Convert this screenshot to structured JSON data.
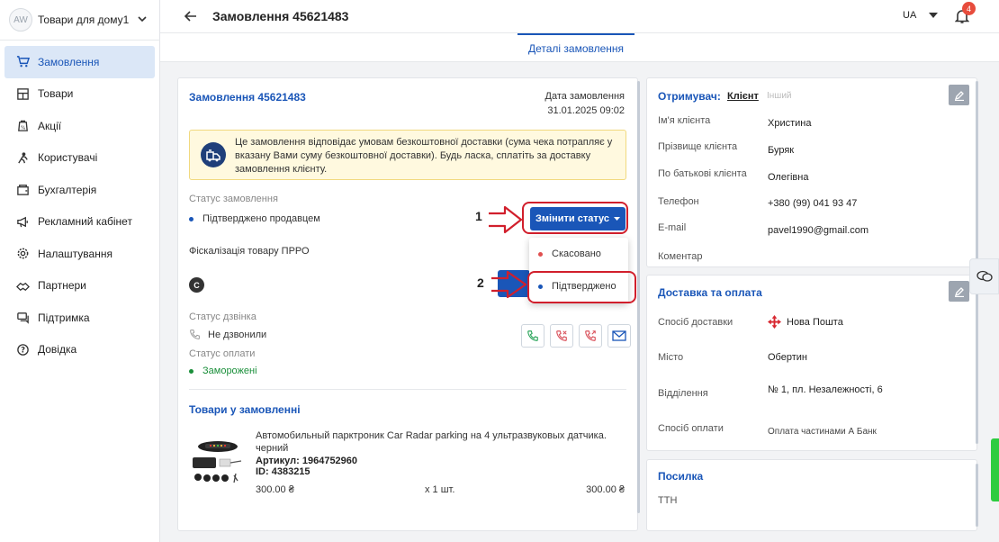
{
  "sidebar": {
    "avatar": "AW",
    "shop_name": "Товари для дому1",
    "items": [
      {
        "label": "Замовлення",
        "icon": "cart-icon",
        "active": true
      },
      {
        "label": "Товари",
        "icon": "store-icon"
      },
      {
        "label": "Акції",
        "icon": "promo-icon"
      },
      {
        "label": "Користувачі",
        "icon": "users-icon"
      },
      {
        "label": "Бухгалтерія",
        "icon": "accounting-icon"
      },
      {
        "label": "Рекламний кабінет",
        "icon": "megaphone-icon"
      },
      {
        "label": "Налаштування",
        "icon": "gear-icon"
      },
      {
        "label": "Партнери",
        "icon": "handshake-icon"
      },
      {
        "label": "Підтримка",
        "icon": "support-icon"
      },
      {
        "label": "Довідка",
        "icon": "help-icon"
      }
    ]
  },
  "header": {
    "title": "Замовлення 45621483",
    "language": "UA",
    "notifications": "4"
  },
  "tabs": {
    "active": "Деталі замовлення"
  },
  "order": {
    "title": "Замовлення 45621483",
    "date_label": "Дата замовлення",
    "date_value": "31.01.2025 09:02",
    "alert": "Це замовлення відповідає умовам безкоштовної доставки (сума чека потрапляє у вказану Вами суму безкоштовної доставки). Будь ласка, сплатіть за доставку замовлення клієнту.",
    "status_label": "Статус замовлення",
    "status_value": "Підтверджено продавцем",
    "change_status_button": "Змінити статус",
    "status_options": [
      "Скасовано",
      "Підтверджено"
    ],
    "fiscal_label": "Фіскалізація товару ПРРО",
    "fiscal_badge": "C",
    "call_label": "Статус дзвінка",
    "call_value": "Не дзвонили",
    "payment_label": "Статус оплати",
    "payment_value": "Заморожені",
    "goods_title": "Товари у замовленні",
    "product": {
      "name": "Автомобильный парктроник Car Radar parking на 4 ультразвуковых датчика. черний",
      "article": "Артикул: 1964752960",
      "id": "ID: 4383215",
      "price": "300.00 ₴",
      "qty": "x 1 шт.",
      "total": "300.00 ₴"
    }
  },
  "recipient": {
    "title": "Отримувач:",
    "seg_client": "Клієнт",
    "seg_other": "Інший",
    "fields": [
      {
        "label": "Ім'я клієнта",
        "value": "Христина"
      },
      {
        "label": "Прізвище клієнта",
        "value": "Буряк"
      },
      {
        "label": "По батькові клієнта",
        "value": "Олегівна"
      },
      {
        "label": "Телефон",
        "value": "+380 (99) 041 93 47"
      },
      {
        "label": "E-mail",
        "value": "pavel1990@gmail.com"
      },
      {
        "label": "Коментар",
        "value": ""
      }
    ]
  },
  "delivery": {
    "title": "Доставка та оплата",
    "fields": [
      {
        "label": "Спосіб доставки",
        "value": "Нова Пошта"
      },
      {
        "label": "Місто",
        "value": "Обертин"
      },
      {
        "label": "Відділення",
        "value": "№ 1, пл. Незалежності, 6"
      },
      {
        "label": "Спосіб оплати",
        "value": "Оплата частинами А Банк"
      }
    ]
  },
  "parcel": {
    "title": "Посилка",
    "ttn_label": "ТТН"
  },
  "annotations": {
    "step1": "1",
    "step2": "2"
  },
  "colors": {
    "accent": "#1a56b8",
    "highlight": "#d11f2c",
    "dot_red": "#e05050",
    "dot_blue": "#1a56b8",
    "dot_green": "#1a8f3a"
  }
}
